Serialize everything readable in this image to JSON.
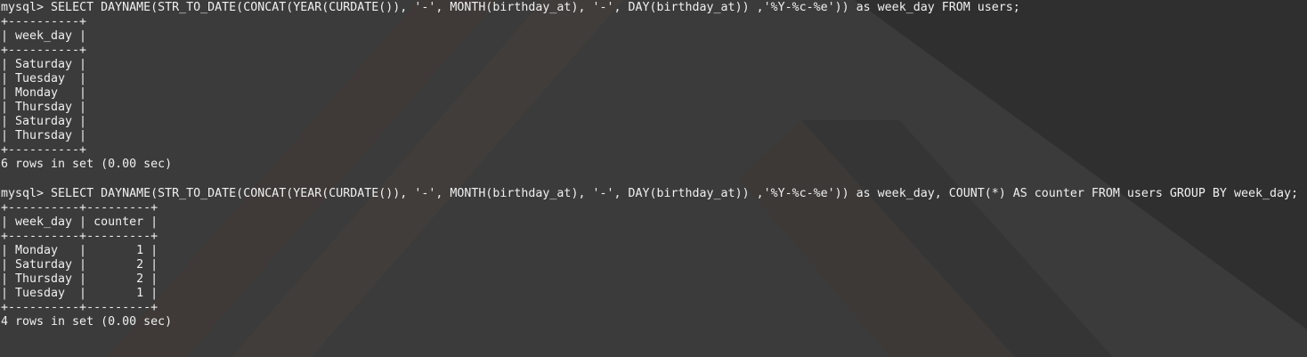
{
  "terminal": {
    "prompt": "mysql> ",
    "blocks": [
      {
        "command": "SELECT DAYNAME(STR_TO_DATE(CONCAT(YEAR(CURDATE()), '-', MONTH(birthday_at), '-', DAY(birthday_at)) ,'%Y-%c-%e')) as week_day FROM users;",
        "table_lines": [
          "+----------+",
          "| week_day |",
          "+----------+",
          "| Saturday |",
          "| Tuesday  |",
          "| Monday   |",
          "| Thursday |",
          "| Saturday |",
          "| Thursday |",
          "+----------+"
        ],
        "result": "6 rows in set (0.00 sec)"
      },
      {
        "command": "SELECT DAYNAME(STR_TO_DATE(CONCAT(YEAR(CURDATE()), '-', MONTH(birthday_at), '-', DAY(birthday_at)) ,'%Y-%c-%e')) as week_day, COUNT(*) AS counter FROM users GROUP BY week_day;",
        "table_lines": [
          "+----------+---------+",
          "| week_day | counter |",
          "+----------+---------+",
          "| Monday   |       1 |",
          "| Saturday |       2 |",
          "| Thursday |       2 |",
          "| Tuesday  |       1 |",
          "+----------+---------+"
        ],
        "result": "4 rows in set (0.00 sec)"
      }
    ]
  }
}
